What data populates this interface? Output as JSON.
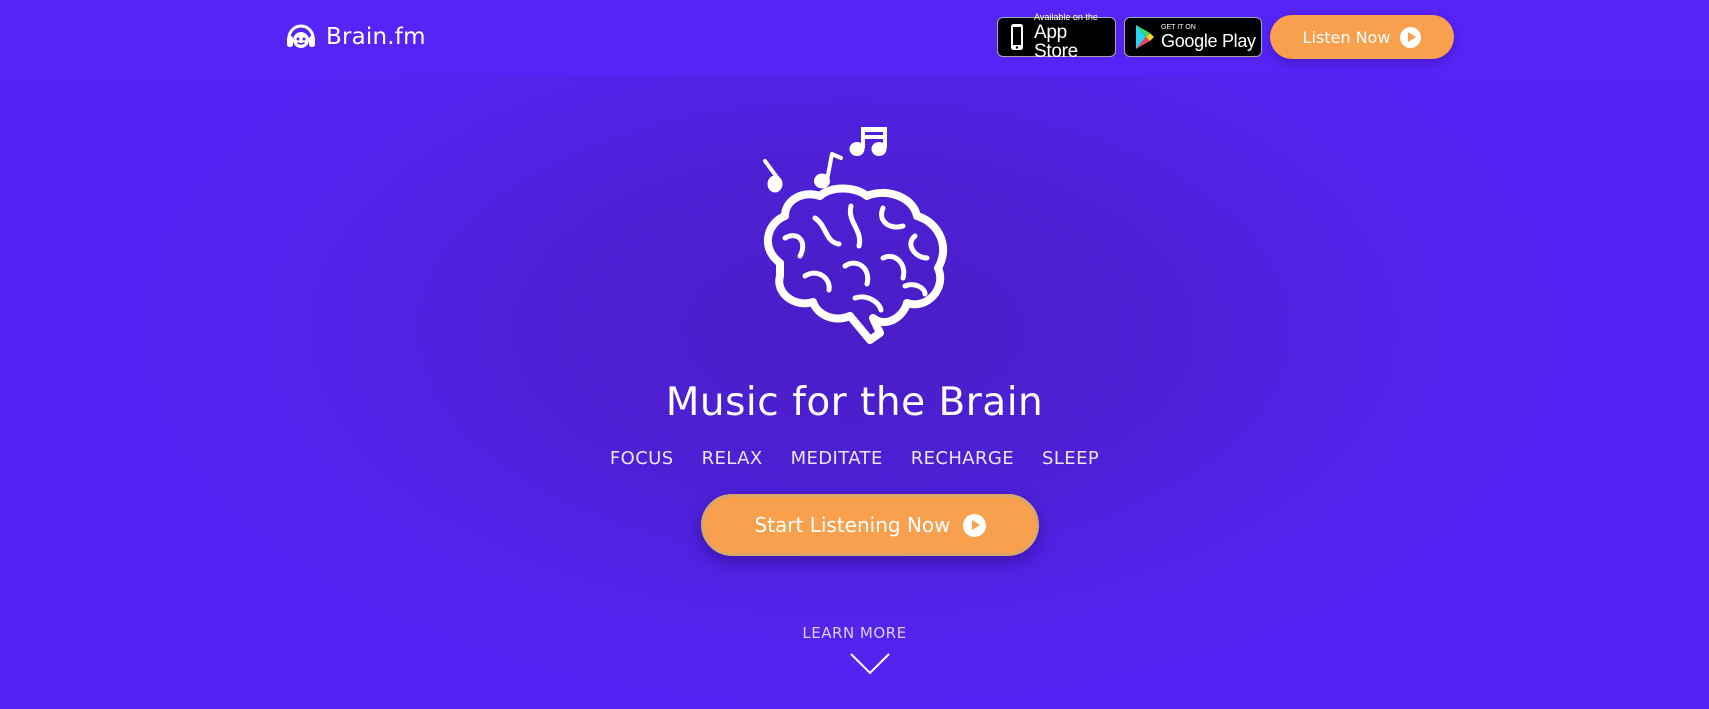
{
  "header": {
    "brand": "Brain.fm",
    "app_store": {
      "small": "Available on the",
      "big": "App Store"
    },
    "google_play": {
      "small": "GET IT ON",
      "big": "Google Play"
    },
    "listen_now": "Listen Now"
  },
  "hero": {
    "title": "Music for the Brain",
    "modes": [
      "FOCUS",
      "RELAX",
      "MEDITATE",
      "RECHARGE",
      "SLEEP"
    ],
    "cta": "Start Listening Now",
    "learn_more": "LEARN MORE"
  },
  "colors": {
    "background": "#5623f4",
    "accent": "#f9a04e",
    "text": "#ffffff"
  },
  "icons": {
    "logo": "headphones-face-icon",
    "apple": "apple-phone-icon",
    "google": "google-play-icon",
    "play": "play-icon",
    "brain": "brain-icon",
    "notes": "music-notes-icon",
    "chevron": "chevron-down-icon"
  }
}
